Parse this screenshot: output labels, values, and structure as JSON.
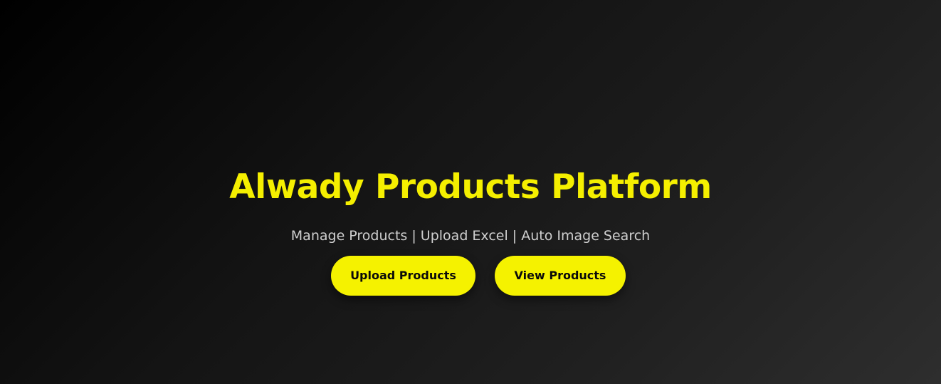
{
  "hero": {
    "title": "Alwady Products Platform",
    "subtitle": "Manage Products | Upload Excel | Auto Image Search",
    "buttons": {
      "upload_label": "Upload Products",
      "view_label": "View Products"
    }
  },
  "colors": {
    "accent": "#f5ef00",
    "subtitle_text": "#cfcfcf",
    "background_start": "#000000",
    "background_end": "#2e2e2e",
    "button_text": "#0a0a0a"
  }
}
